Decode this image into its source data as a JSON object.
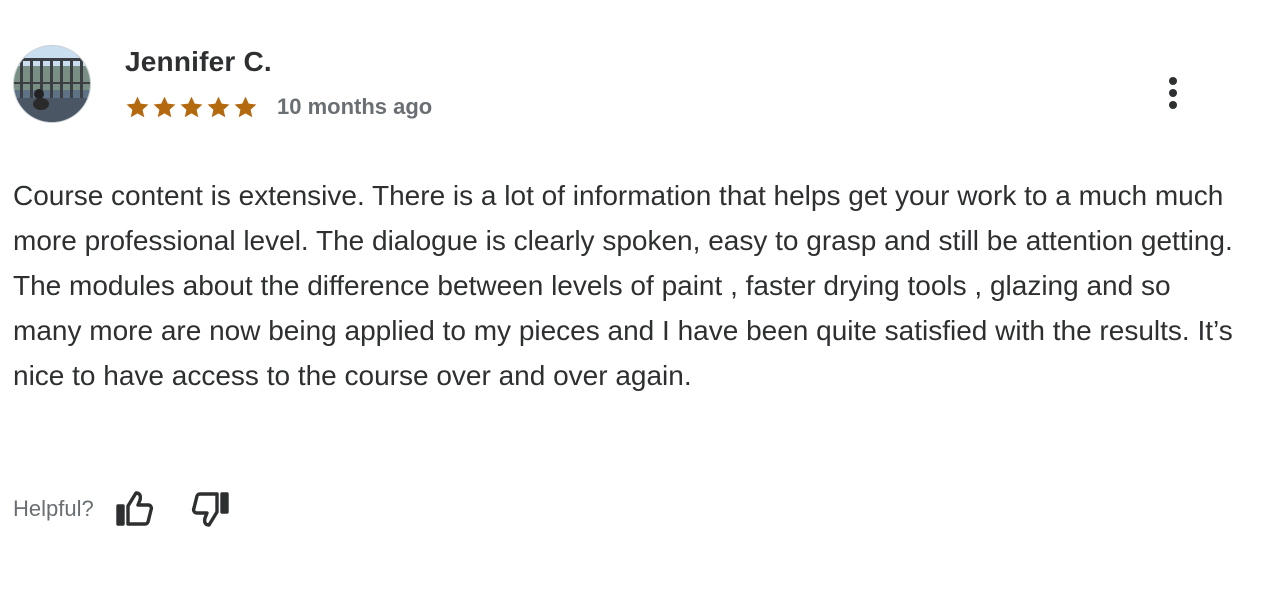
{
  "review": {
    "reviewer_name": "Jennifer C.",
    "rating": 5,
    "rating_max": 5,
    "date": "10 months ago",
    "text": "Course content is extensive. There is a lot of information that helps get your work to a much much more professional level. The dialogue is clearly spoken, easy to grasp and still be attention getting. The modules about the difference between levels of paint , faster drying tools , glazing and so many more are now being applied to my pieces and I have been quite satisfied with the results. It’s nice to have access to the course over and over again.",
    "helpful_label": "Helpful?"
  },
  "icons": {
    "avatar": "user-photo",
    "star": "star-icon",
    "more": "vertical-dots-icon",
    "thumbs_up": "thumbs-up-icon",
    "thumbs_down": "thumbs-down-icon"
  },
  "colors": {
    "star": "#b4690e",
    "text": "#2d2f31",
    "muted": "#6a6f73"
  }
}
